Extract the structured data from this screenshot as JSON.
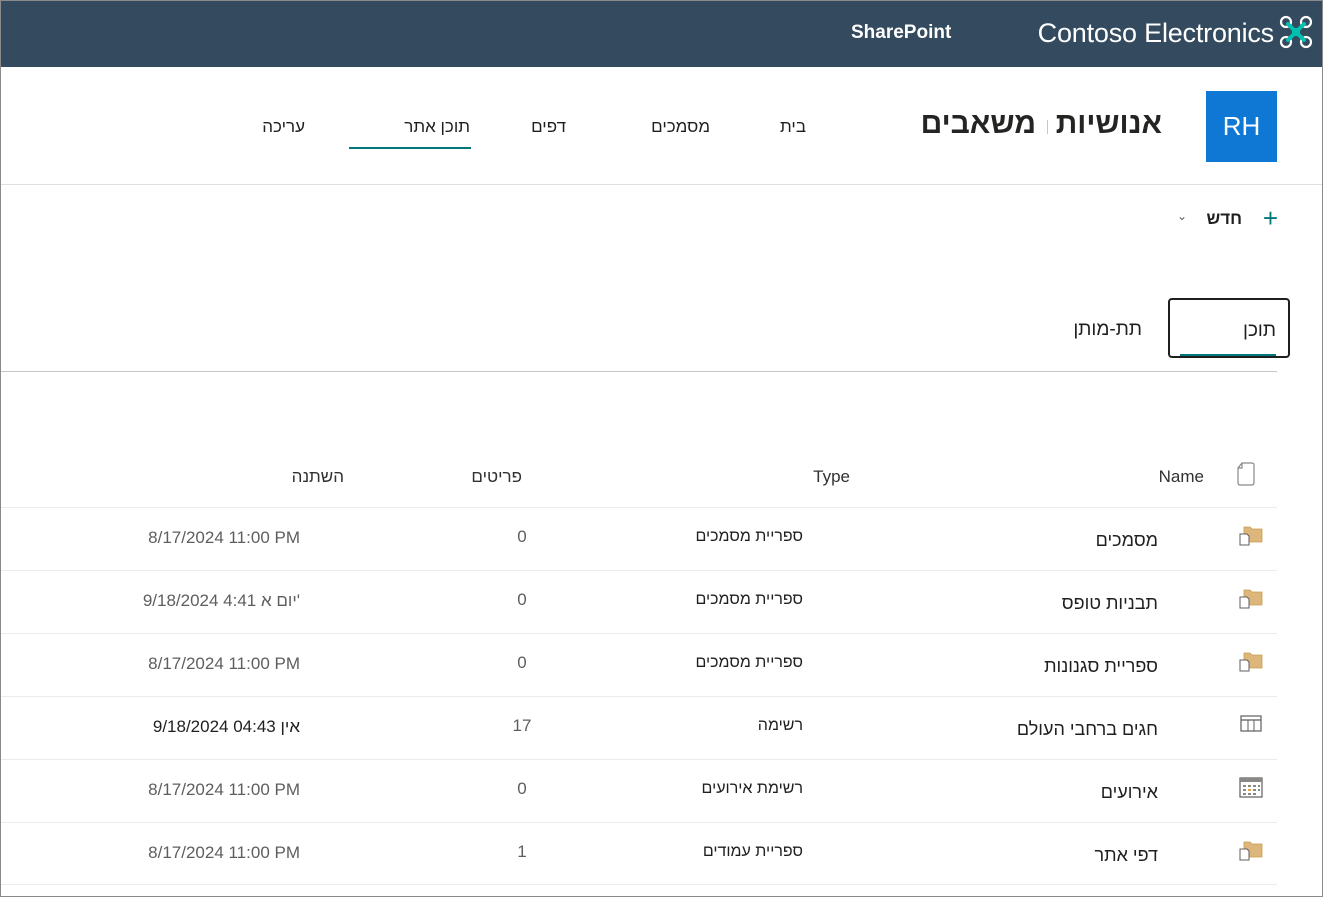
{
  "suite_bar": {
    "brand": "Contoso Electronics",
    "app_name": "SharePoint",
    "logo_icon": "drone-logo-icon",
    "logo_color": "#00c0b0"
  },
  "site": {
    "logo_initials": "RH",
    "title_primary": "אנושיות",
    "title_secondary": "משאבים",
    "nav": {
      "home": "בית",
      "documents": "מסמכים",
      "pages": "דפים",
      "site_contents": "תוכן אתר",
      "edit": "עריכה"
    }
  },
  "command_bar": {
    "new_label": "חדש",
    "new_icon": "plus-icon",
    "chevron_icon": "chevron-down-icon"
  },
  "pivot": {
    "contents": "תוכן",
    "subsites": "תת-מותן"
  },
  "table": {
    "headers": {
      "name": "Name",
      "type": "Type",
      "items": "פריטים",
      "modified": "השתנה"
    },
    "rows": [
      {
        "icon": "document-library-icon",
        "name": "מסמכים",
        "type": "ספריית מסמכים",
        "items": "0",
        "modified": "8/17/2024 11:00 PM"
      },
      {
        "icon": "document-library-icon",
        "name": "תבניות טופס",
        "type": "ספריית מסמכים",
        "items": "0",
        "modified": "9/18/2024 4:41 יום א'"
      },
      {
        "icon": "document-library-icon",
        "name": "ספריית סגנונות",
        "type": "ספריית מסמכים",
        "items": "0",
        "modified": "8/17/2024 11:00 PM"
      },
      {
        "icon": "list-icon",
        "name": "חגים ברחבי העולם",
        "type": "רשימה",
        "items": "17",
        "modified": "9/18/2024 אין 04:43"
      },
      {
        "icon": "calendar-icon",
        "name": "אירועים",
        "type": "רשימת אירועים",
        "items": "0",
        "modified": "8/17/2024 11:00 PM"
      },
      {
        "icon": "document-library-icon",
        "name": "דפי אתר",
        "type": "ספריית עמודים",
        "items": "1",
        "modified": "8/17/2024 11:00 PM"
      }
    ]
  }
}
